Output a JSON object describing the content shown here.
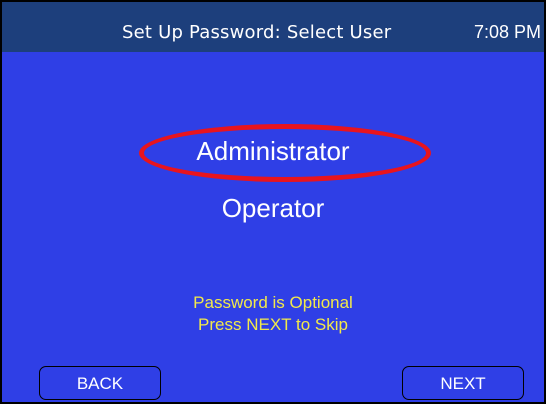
{
  "header": {
    "title": "Set Up Password: Select User",
    "time": "7:08 PM"
  },
  "options": [
    {
      "label": "Administrator",
      "highlighted": true
    },
    {
      "label": "Operator",
      "highlighted": false
    }
  ],
  "notice": {
    "line1": "Password is Optional",
    "line2": "Press NEXT to Skip"
  },
  "buttons": {
    "back": "BACK",
    "next": "NEXT"
  },
  "colors": {
    "header_bg": "#1d3f7c",
    "screen_bg": "#2f3fe6",
    "highlight": "#e8141e",
    "notice_text": "#f2e94a"
  }
}
